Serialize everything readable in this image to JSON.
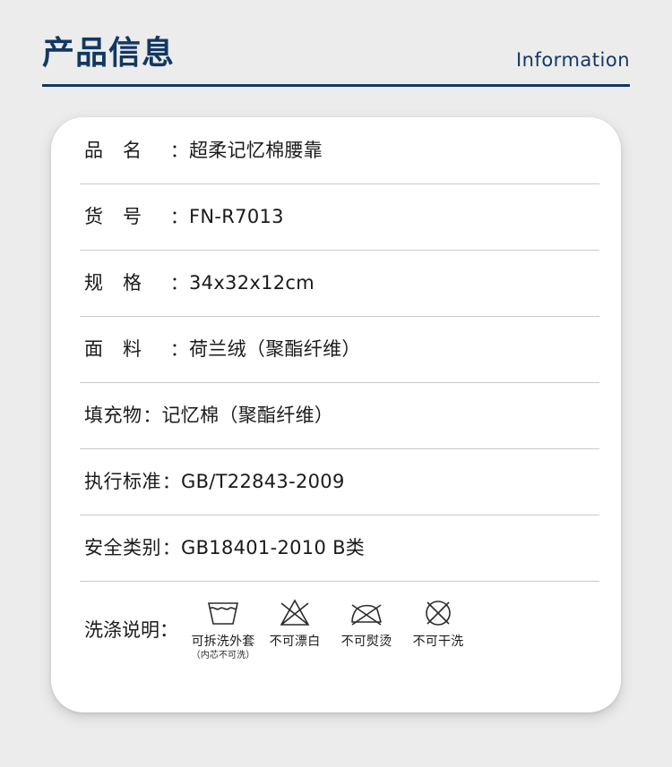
{
  "header": {
    "title": "产品信息",
    "subtitle": "Information",
    "accent_color": "#123863"
  },
  "card": {
    "background_color": "#ffffff",
    "divider_color": "#c9c9c9",
    "rows": [
      {
        "label": "品　名",
        "colon": "：",
        "value": "超柔记忆棉腰靠",
        "two_char": true
      },
      {
        "label": "货　号",
        "colon": "：",
        "value": "FN-R7013",
        "two_char": true
      },
      {
        "label": "规　格",
        "colon": "：",
        "value": "34x32x12cm",
        "two_char": true
      },
      {
        "label": "面　料",
        "colon": "：",
        "value": "荷兰绒（聚酯纤维）",
        "two_char": true
      },
      {
        "label": "填充物",
        "colon": "：",
        "value": "记忆棉（聚酯纤维）",
        "two_char": false
      },
      {
        "label": "执行标准",
        "colon": "：",
        "value": "GB/T22843-2009",
        "two_char": false
      },
      {
        "label": "安全类别",
        "colon": "：",
        "value": "GB18401-2010 B类",
        "two_char": false
      }
    ],
    "washing": {
      "label": "洗涤说明：",
      "icons": [
        {
          "icon": "washtub-icon",
          "caption": "可拆洗外套",
          "subcaption": "（内芯不可洗）"
        },
        {
          "icon": "no-bleach-triangle-icon",
          "caption": "不可漂白",
          "subcaption": ""
        },
        {
          "icon": "no-iron-icon",
          "caption": "不可熨烫",
          "subcaption": ""
        },
        {
          "icon": "no-dryclean-circle-icon",
          "caption": "不可干洗",
          "subcaption": ""
        }
      ]
    }
  },
  "page": {
    "background_color": "#ececec"
  }
}
